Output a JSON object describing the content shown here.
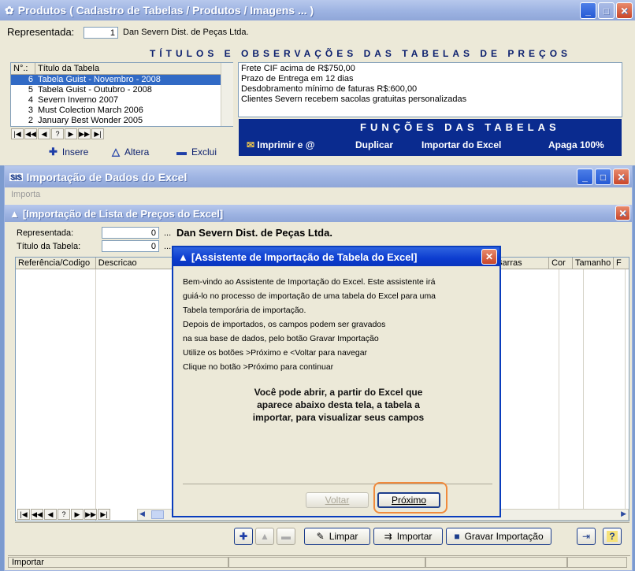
{
  "products_window": {
    "title": "Produtos ( Cadastro de Tabelas / Produtos / Imagens ... )",
    "representada_label": "Representada:",
    "representada_code": "1",
    "representada_name": "Dan Severn Dist. de Peças Ltda.",
    "observacoes_title": "TÍTULOS E OBSERVAÇÕES DAS TABELAS DE PREÇOS",
    "table_columns": [
      "N°.:",
      "Título da Tabela"
    ],
    "tables": [
      {
        "num": "6",
        "title": "Tabela Guist - Novembro - 2008",
        "selected": true
      },
      {
        "num": "5",
        "title": "Tabela Guist - Outubro - 2008",
        "selected": false
      },
      {
        "num": "4",
        "title": "Severn Inverno 2007",
        "selected": false
      },
      {
        "num": "3",
        "title": "Must Colection March 2006",
        "selected": false
      },
      {
        "num": "2",
        "title": "January Best Wonder 2005",
        "selected": false
      }
    ],
    "observacoes": [
      "Frete CIF acima de R$750,00",
      "Prazo de Entrega em 12 dias",
      "Desdobramento mínimo de faturas R$:600,00",
      "Clientes Severn recebem sacolas gratuitas personalizadas"
    ],
    "nav_buttons": [
      "|◀",
      "◀◀",
      "◀",
      "?",
      "▶",
      "▶▶",
      "▶|"
    ],
    "insere": "Insere",
    "altera": "Altera",
    "exclui": "Exclui",
    "funcoes_title": "FUNÇÕES DAS TABELAS",
    "imprimir": "Imprimir e @",
    "duplicar": "Duplicar",
    "importar_excel": "Importar do Excel",
    "apaga": "Apaga 100%"
  },
  "import_window": {
    "title": "Importação de Dados do Excel",
    "menu": "Importa",
    "subtitle": "[Importação de Lista de Preços do Excel]",
    "representada_label": "Representada:",
    "representada_value": "0",
    "representada_name": "Dan Severn Dist. de Peças Ltda.",
    "titulo_label": "Título da Tabela:",
    "titulo_value": "0",
    "ellipsis": "...",
    "columns": [
      "Referência/Codigo",
      "Descricao",
      "digo Barras",
      "Cor",
      "Tamanho",
      "F"
    ],
    "nav_buttons": [
      "|◀",
      "◀◀",
      "◀",
      "?",
      "▶",
      "▶▶",
      "▶|"
    ],
    "limpar": "Limpar",
    "importar": "Importar",
    "gravar": "Gravar Importação",
    "status": "Importar"
  },
  "wizard": {
    "title": "[Assistente de Importação de Tabela do Excel]",
    "lines": [
      "Bem-vindo ao Assistente de Importação do Excel. Este assistente irá",
      "guiá-lo no processo de importação de uma tabela do Excel para uma",
      "Tabela temporária de importação.",
      "Depois de importados, os campos podem ser gravados",
      "na sua  base de dados, pelo botão Gravar Importação",
      "Utilize os botões >Próximo e <Voltar para navegar",
      "Clique no botão >Próximo para continuar"
    ],
    "bold_lines": [
      "Você pode abrir, a partir do Excel que",
      "aparece abaixo desta tela, a tabela a",
      "importar, para visualizar seus campos"
    ],
    "voltar": "Voltar",
    "proximo": "Próximo"
  }
}
